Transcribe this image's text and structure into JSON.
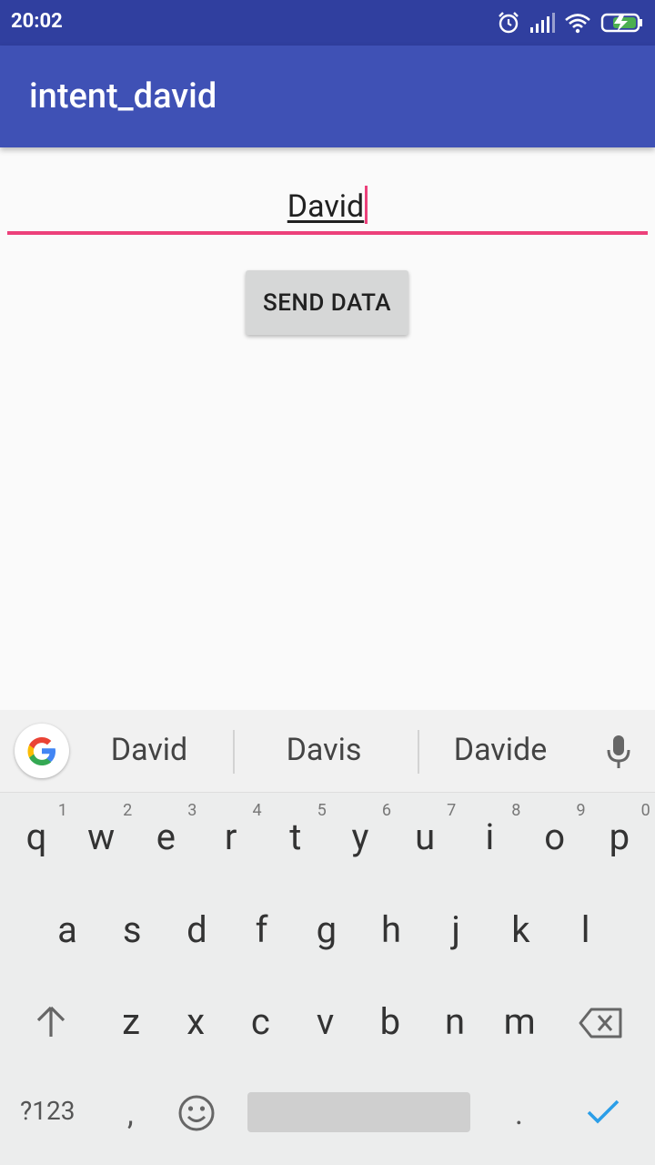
{
  "status": {
    "time": "20:02"
  },
  "app": {
    "title": "intent_david"
  },
  "form": {
    "name_value": "David",
    "send_label": "SEND DATA"
  },
  "keyboard": {
    "suggestions": [
      "David",
      "Davis",
      "Davide"
    ],
    "row1": [
      {
        "k": "q",
        "n": "1"
      },
      {
        "k": "w",
        "n": "2"
      },
      {
        "k": "e",
        "n": "3"
      },
      {
        "k": "r",
        "n": "4"
      },
      {
        "k": "t",
        "n": "5"
      },
      {
        "k": "y",
        "n": "6"
      },
      {
        "k": "u",
        "n": "7"
      },
      {
        "k": "i",
        "n": "8"
      },
      {
        "k": "o",
        "n": "9"
      },
      {
        "k": "p",
        "n": "0"
      }
    ],
    "row2": [
      "a",
      "s",
      "d",
      "f",
      "g",
      "h",
      "j",
      "k",
      "l"
    ],
    "row3": [
      "z",
      "x",
      "c",
      "v",
      "b",
      "n",
      "m"
    ],
    "symbols_label": "?123",
    "comma": ",",
    "period": ".",
    "icons": {
      "google": "google-icon",
      "mic": "mic-icon",
      "shift": "shift-icon",
      "backspace": "backspace-icon",
      "emoji": "emoji-icon",
      "enter": "check-icon"
    }
  },
  "colors": {
    "statusbar": "#303f9f",
    "appbar": "#3f51b5",
    "accent": "#ec407a",
    "enter": "#2b9ee8"
  }
}
